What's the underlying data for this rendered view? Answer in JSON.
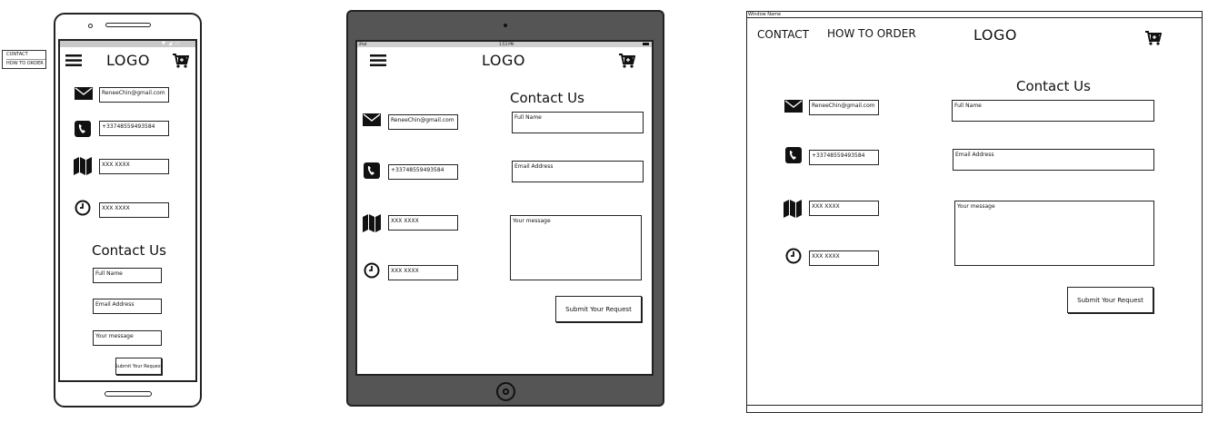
{
  "mobile": {
    "popup_menu": [
      "CONTACT",
      "HOW TO ORDER"
    ],
    "logo": "LOGO",
    "contact_title": "Contact Us",
    "info": {
      "email": "ReneeChin@gmail.com",
      "phone": "+33748559493584",
      "address": "XXX XXXX",
      "hours": "XXX XXXX"
    },
    "form": {
      "full_name": "Full Name",
      "email": "Email Address",
      "message": "Your message",
      "submit": "Submit Your Request"
    }
  },
  "tablet": {
    "status_left": "iPad",
    "status_time": "1:53 PM",
    "logo": "LOGO",
    "contact_title": "Contact Us",
    "info": {
      "email": "ReneeChin@gmail.com",
      "phone": "+33748559493584",
      "address": "XXX XXXX",
      "hours": "XXX XXXX"
    },
    "form": {
      "full_name": "Full Name",
      "email": "Email Address",
      "message": "Your message",
      "submit": "Submit Your Request"
    }
  },
  "desktop": {
    "window_name": "Window Name",
    "nav": [
      "CONTACT",
      "HOW TO ORDER"
    ],
    "logo": "LOGO",
    "contact_title": "Contact Us",
    "info": {
      "email": "ReneeChin@gmail.com",
      "phone": "+33748559493584",
      "address": "XXX XXXX",
      "hours": "XXX XXXX"
    },
    "form": {
      "full_name": "Full Name",
      "email": "Email Address",
      "message": "Your message",
      "submit": "Submit Your Request"
    }
  }
}
